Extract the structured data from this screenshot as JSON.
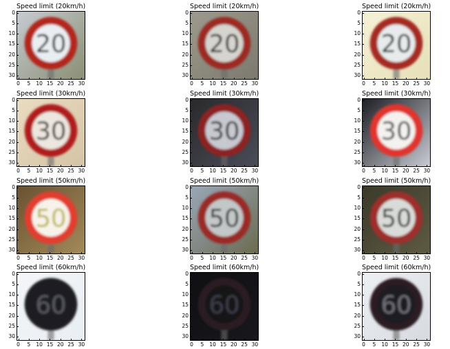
{
  "figure": {
    "rows": [
      {
        "sign_number": "20",
        "panels": [
          {
            "title": "Speed limit (20km/h)",
            "bg": "#c7cbd1",
            "bg2": "#8a8f74",
            "ring": "#b3261e",
            "face": "#e9eef2",
            "digits": "#1a1a1a"
          },
          {
            "title": "Speed limit (20km/h)",
            "bg": "#9d9a8d",
            "bg2": "#7c796e",
            "ring": "#9c2a24",
            "face": "#d6d4cf",
            "digits": "#1e1e1e"
          },
          {
            "title": "Speed limit (20km/h)",
            "bg": "#f6f2d7",
            "bg2": "#e6dfb8",
            "ring": "#a52a22",
            "face": "#e7ebec",
            "digits": "#1a1a1a"
          }
        ]
      },
      {
        "sign_number": "30",
        "panels": [
          {
            "title": "Speed limit (30km/h)",
            "bg": "#eadcc2",
            "bg2": "#d5c4a4",
            "ring": "#b01f1b",
            "face": "#ece6de",
            "digits": "#1b1b1b"
          },
          {
            "title": "Speed limit (30km/h)",
            "bg": "#2a2a2c",
            "bg2": "#4a4c58",
            "ring": "#8d2224",
            "face": "#c7c8d0",
            "digits": "#1f1f24"
          },
          {
            "title": "Speed limit (30km/h)",
            "bg": "#1e1f25",
            "bg2": "#c9ccd3",
            "ring": "#e0362e",
            "face": "#f4f2ef",
            "digits": "#3a3a3a"
          }
        ]
      },
      {
        "sign_number": "50",
        "panels": [
          {
            "title": "Speed limit (50km/h)",
            "bg": "#6a5232",
            "bg2": "#a28a5a",
            "ring": "#e23c2f",
            "face": "#f7f3ea",
            "digits": "#b8b446"
          },
          {
            "title": "Speed limit (50km/h)",
            "bg": "#9aa7b8",
            "bg2": "#6b6b4f",
            "ring": "#9a2a28",
            "face": "#c3c7c7",
            "digits": "#1d2a25"
          },
          {
            "title": "Speed limit (50km/h)",
            "bg": "#3b3a2a",
            "bg2": "#5e5a42",
            "ring": "#9d2e2a",
            "face": "#d9dbd8",
            "digits": "#1c2621"
          }
        ]
      },
      {
        "sign_number": "60",
        "panels": [
          {
            "title": "Speed limit (60km/h)",
            "bg": "#f4f6f8",
            "bg2": "#e9eef3",
            "ring": "#1c1c22",
            "face": "#1a1a20",
            "digits": "#5a5a64"
          },
          {
            "title": "Speed limit (60km/h)",
            "bg": "#101013",
            "bg2": "#17171c",
            "ring": "#2a1c22",
            "face": "#141418",
            "digits": "#3c3c4c"
          },
          {
            "title": "Speed limit (60km/h)",
            "bg": "#eef1f4",
            "bg2": "#d6d9df",
            "ring": "#2a1e22",
            "face": "#1e1e22",
            "digits": "#707078"
          }
        ]
      }
    ],
    "y_ticks": [
      "0",
      "5",
      "10",
      "15",
      "20",
      "25",
      "30"
    ],
    "x_ticks": [
      "0",
      "5",
      "10",
      "15",
      "20",
      "25",
      "30"
    ]
  }
}
